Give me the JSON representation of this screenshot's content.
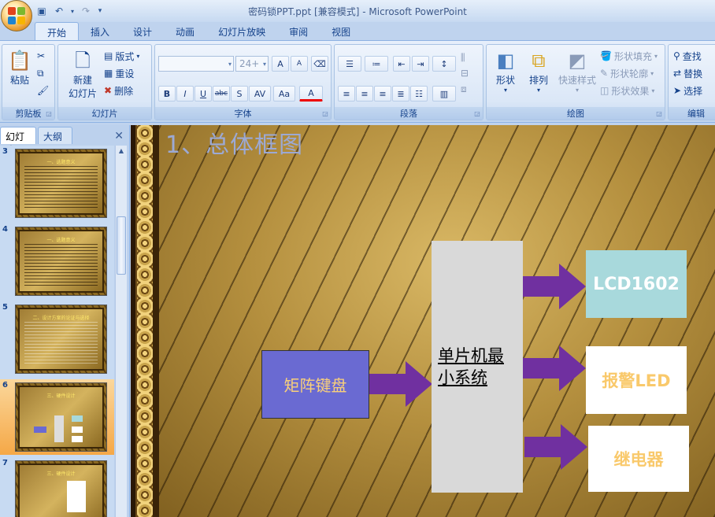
{
  "window": {
    "title": "密码锁PPT.ppt [兼容模式] - Microsoft PowerPoint"
  },
  "qat": [
    {
      "name": "save-icon",
      "glyph": "💾"
    },
    {
      "name": "undo-icon",
      "glyph": "↶"
    },
    {
      "name": "redo-icon",
      "glyph": "↷"
    },
    {
      "name": "customize-icon",
      "glyph": "▾"
    }
  ],
  "tabs": [
    {
      "label": "开始",
      "active": true
    },
    {
      "label": "插入"
    },
    {
      "label": "设计"
    },
    {
      "label": "动画"
    },
    {
      "label": "幻灯片放映"
    },
    {
      "label": "审阅"
    },
    {
      "label": "视图"
    }
  ],
  "ribbon": {
    "clipboard": {
      "label": "剪贴板",
      "paste": "粘贴"
    },
    "slides": {
      "label": "幻灯片",
      "new_slide_1": "新建",
      "new_slide_2": "幻灯片",
      "layout": "版式",
      "reset": "重设",
      "delete": "删除"
    },
    "font": {
      "label": "字体",
      "size": "24+",
      "bold": "B",
      "italic": "I",
      "underline": "U",
      "strike": "abc",
      "shadow": "S",
      "spacing": "AV",
      "case": "Aa",
      "color": "A",
      "grow": "A",
      "shrink": "A"
    },
    "paragraph": {
      "label": "段落"
    },
    "drawing": {
      "label": "绘图",
      "shapes": "形状",
      "arrange": "排列",
      "quick_styles": "快速样式",
      "shape_fill": "形状填充",
      "shape_outline": "形状轮廓",
      "shape_effects": "形状效果"
    },
    "editing": {
      "label": "编辑",
      "find": "查找",
      "replace": "替换",
      "select": "选择"
    }
  },
  "pane": {
    "tab_slides": "幻灯片",
    "tab_outline": "大纲",
    "close": "✕",
    "thumbnails": [
      {
        "num": "3",
        "title": "一、选题意义",
        "type": "text"
      },
      {
        "num": "4",
        "title": "一、选题意义",
        "type": "text"
      },
      {
        "num": "5",
        "title": "二、设计方案的论证与选择",
        "type": "text"
      },
      {
        "num": "6",
        "title": "三、硬件设计",
        "type": "diagram",
        "selected": true
      },
      {
        "num": "7",
        "title": "三、硬件设计",
        "type": "text"
      }
    ]
  },
  "slide": {
    "title": "1、总体框图",
    "keyboard": "矩阵键盘",
    "mcu": "单片机最小系统",
    "lcd": "LCD1602",
    "led": "报警LED",
    "relay": "继电器"
  },
  "colors": {
    "arrow": "#7030a0",
    "keyboard_fill": "#6a6ad2",
    "lcd_fill": "#a8d9dc"
  }
}
